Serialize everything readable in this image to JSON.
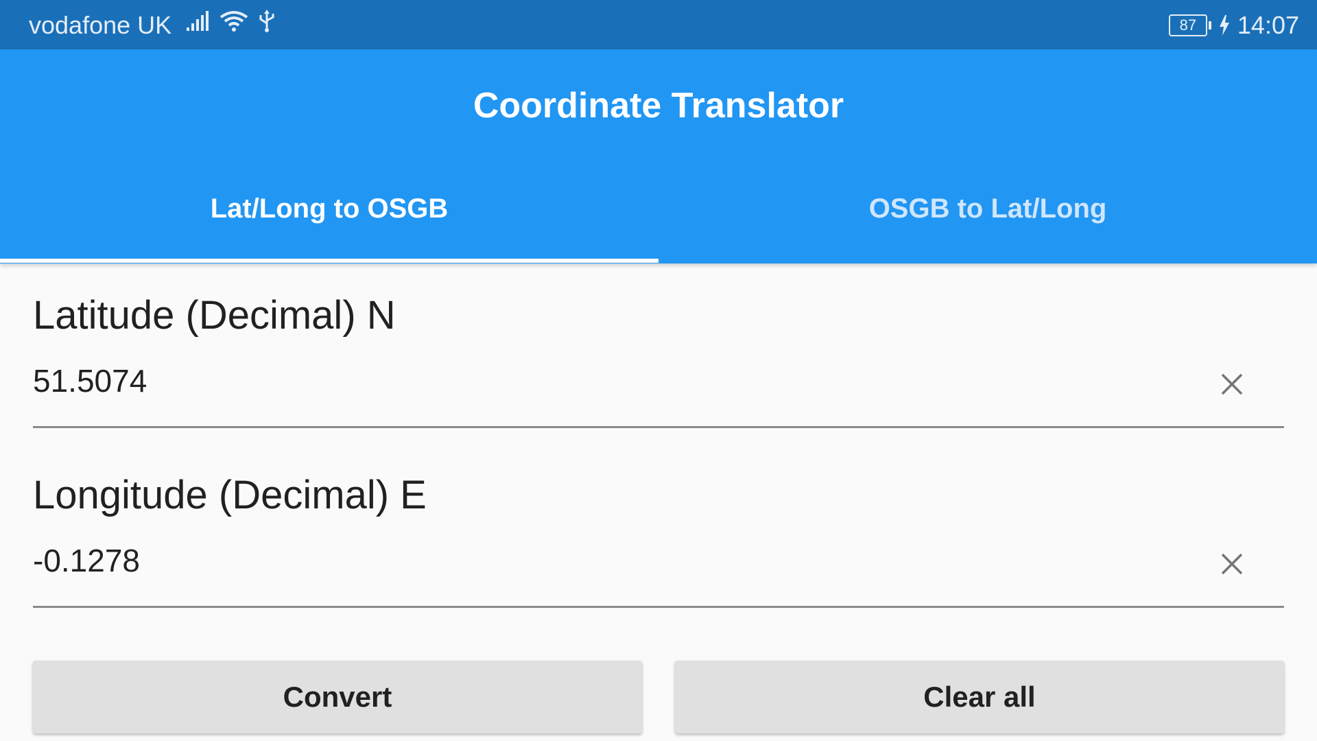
{
  "status_bar": {
    "carrier": "vodafone UK",
    "battery_level": "87",
    "time": "14:07",
    "icons": [
      "signal-icon",
      "wifi-icon",
      "usb-icon",
      "battery-icon",
      "charging-icon"
    ]
  },
  "app_bar": {
    "title": "Coordinate Translator",
    "tabs": [
      {
        "label": "Lat/Long to OSGB",
        "selected": true
      },
      {
        "label": "OSGB to Lat/Long",
        "selected": false
      }
    ]
  },
  "form": {
    "latitude": {
      "label": "Latitude (Decimal) N",
      "value": "51.5074"
    },
    "longitude": {
      "label": "Longitude (Decimal) E",
      "value": "-0.1278"
    }
  },
  "actions": {
    "convert_label": "Convert",
    "clear_label": "Clear all"
  },
  "colors": {
    "status_bar": "#1a70b8",
    "app_bar": "#2196f3",
    "background": "#fafafa",
    "button": "#e0e0e0"
  }
}
